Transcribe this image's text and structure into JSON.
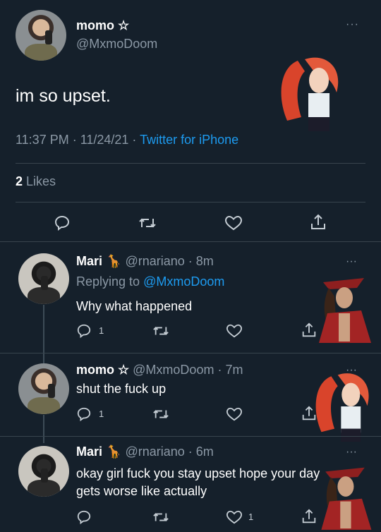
{
  "main_tweet": {
    "display_name": "momo ☆",
    "handle": "@MxmoDoom",
    "text": "im so upset.",
    "time_date": "11:37 PM · 11/24/21 · ",
    "source": "Twitter for iPhone",
    "likes_count": "2",
    "likes_label": "Likes"
  },
  "replies": [
    {
      "display_name": "Mari",
      "emoji": "🦒",
      "handle_time": "@rnariano · 8m",
      "replying_prefix": "Replying to ",
      "replying_to": "@MxmoDoom",
      "text": "Why what happened",
      "reply_count": "1",
      "like_count": ""
    },
    {
      "display_name": "momo ☆",
      "handle_time": "@MxmoDoom · 7m",
      "text": "shut the fuck up",
      "reply_count": "1",
      "like_count": ""
    },
    {
      "display_name": "Mari",
      "emoji": "🦒",
      "handle_time": "@rnariano · 6m",
      "text_line1": "okay girl fuck you stay upset hope your day",
      "text_line2": "gets worse like actually",
      "reply_count": "",
      "like_count": "1"
    }
  ],
  "more_glyph": "···",
  "icons": [
    "reply-icon",
    "retweet-icon",
    "like-icon",
    "share-icon",
    "more-icon",
    "avatar",
    "giraffe-emoji"
  ],
  "colors": {
    "background": "#15202b",
    "link": "#1d9bf0",
    "muted": "#8b98a5",
    "divider": "#38444d"
  }
}
